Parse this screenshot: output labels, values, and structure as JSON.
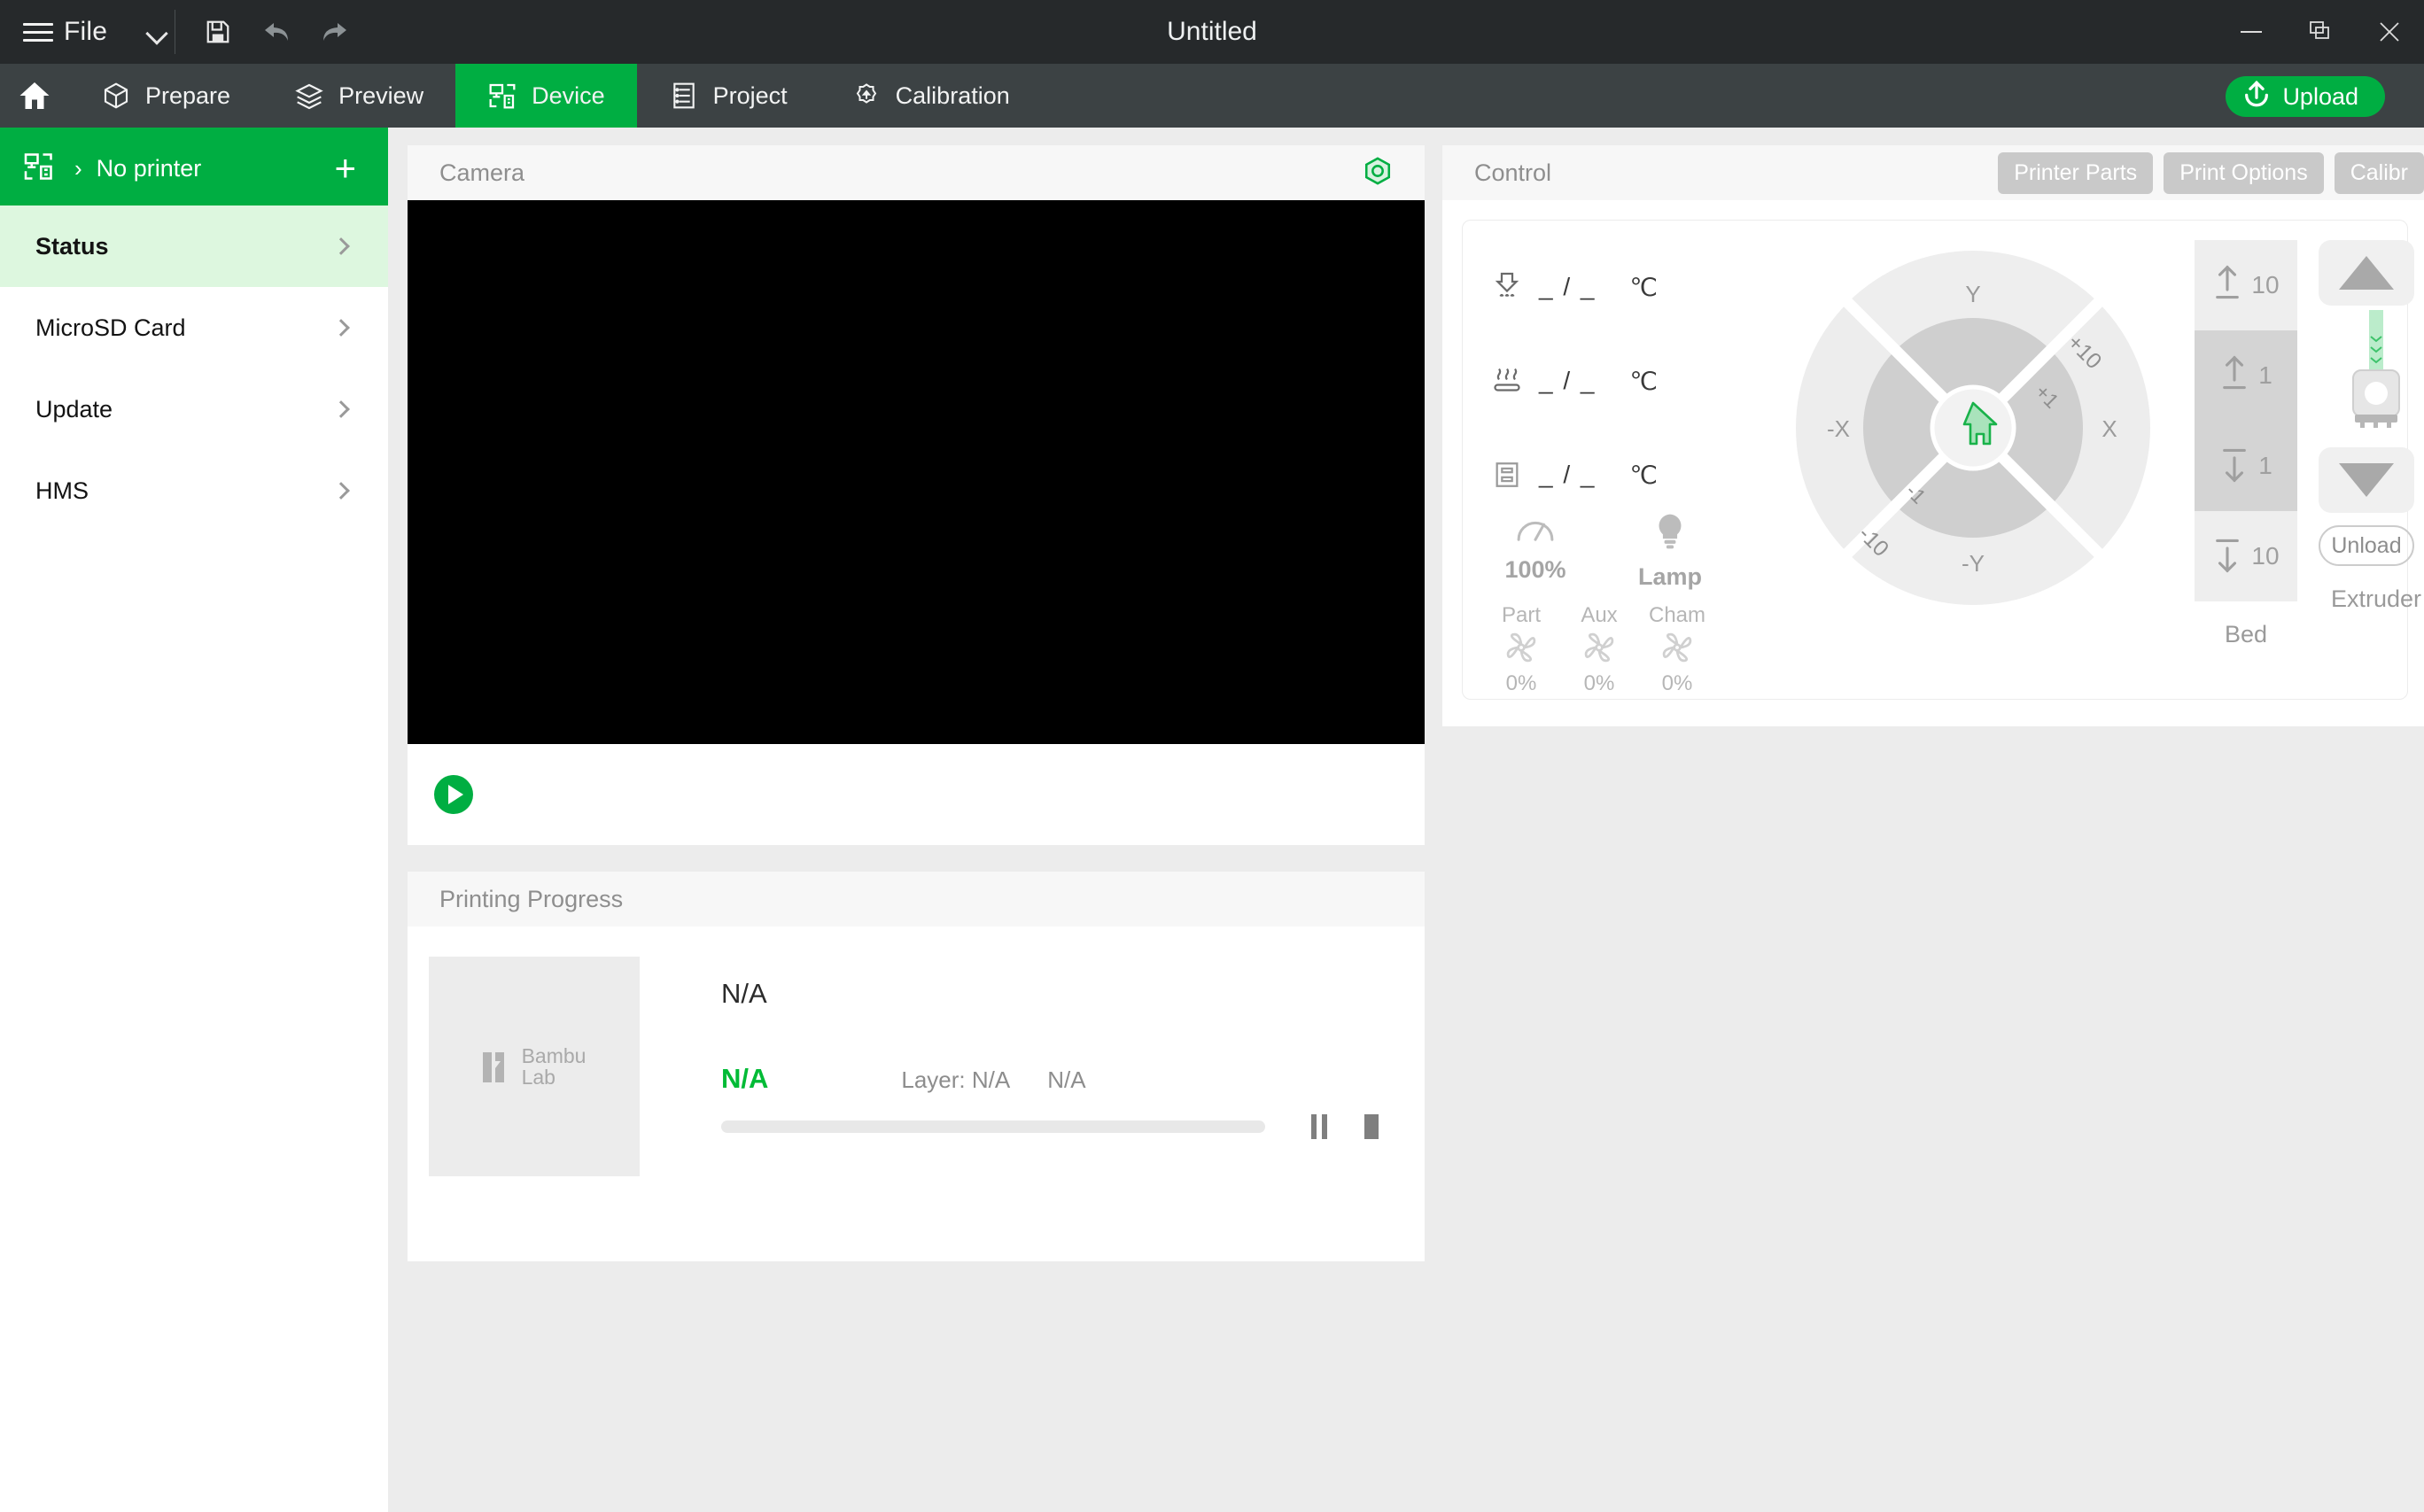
{
  "titlebar": {
    "file_label": "File",
    "title": "Untitled",
    "icons": {
      "menu": "hamburger-icon",
      "dropdown": "chevron-down-icon",
      "save": "save-icon",
      "undo": "undo-icon",
      "redo": "redo-icon",
      "minimize": "minimize-icon",
      "restore": "restore-icon",
      "close": "close-icon"
    }
  },
  "navbar": {
    "home_label": "Home",
    "tabs": [
      {
        "label": "Prepare",
        "icon": "cube-icon",
        "active": false
      },
      {
        "label": "Preview",
        "icon": "layers-icon",
        "active": false
      },
      {
        "label": "Device",
        "icon": "device-monitor-icon",
        "active": true
      },
      {
        "label": "Project",
        "icon": "list-document-icon",
        "active": false
      },
      {
        "label": "Calibration",
        "icon": "gear-calibration-icon",
        "active": false
      }
    ],
    "upload_label": "Upload",
    "accent_color": "#00ae42"
  },
  "sidebar": {
    "printer_name": "No printer",
    "add_label": "+",
    "items": [
      {
        "label": "Status",
        "active": true
      },
      {
        "label": "MicroSD Card",
        "active": false
      },
      {
        "label": "Update",
        "active": false
      },
      {
        "label": "HMS",
        "active": false
      }
    ]
  },
  "camera": {
    "title": "Camera",
    "settings_icon": "camera-aperture-icon",
    "play_label": "Play"
  },
  "progress": {
    "title": "Printing Progress",
    "thumbnail_brand_line1": "Bambu",
    "thumbnail_brand_line2": "Lab",
    "task_name": "N/A",
    "percent": "N/A",
    "layer_label": "Layer: N/A",
    "time_remaining": "N/A",
    "progress_value": 0,
    "pause_label": "Pause",
    "stop_label": "Stop"
  },
  "control": {
    "title": "Control",
    "buttons": [
      "Printer Parts",
      "Print Options",
      "Calibr"
    ],
    "temperatures": [
      {
        "icon": "nozzle-temp-icon",
        "value": "_ / _",
        "unit": "℃"
      },
      {
        "icon": "bed-temp-icon",
        "value": "_ / _",
        "unit": "℃"
      },
      {
        "icon": "chamber-temp-icon",
        "value": "_ / _",
        "unit": "℃"
      }
    ],
    "speed": {
      "icon": "gauge-icon",
      "value": "100%"
    },
    "lamp": {
      "icon": "lamp-bulb-icon",
      "label": "Lamp"
    },
    "fans": [
      {
        "name": "Part",
        "value": "0%"
      },
      {
        "name": "Aux",
        "value": "0%"
      },
      {
        "name": "Cham",
        "value": "0%"
      }
    ],
    "axis_wheel": {
      "up_label": "Y",
      "down_label": "-Y",
      "left_label": "-X",
      "right_label": "X",
      "outer_step_pos": "+10",
      "outer_step_neg": "-10",
      "inner_step_pos": "+1",
      "inner_step_neg": "-1",
      "home_icon": "home-icon"
    },
    "bed": {
      "label": "Bed",
      "steps": [
        {
          "dir": "up",
          "value": "10"
        },
        {
          "dir": "up",
          "value": "1"
        },
        {
          "dir": "down",
          "value": "1"
        },
        {
          "dir": "down",
          "value": "10"
        }
      ]
    },
    "extruder": {
      "label": "Extruder",
      "up_icon": "triangle-up-icon",
      "down_icon": "triangle-down-icon",
      "filament_icon": "extruder-filament-icon",
      "unload_label": "Unload"
    }
  }
}
